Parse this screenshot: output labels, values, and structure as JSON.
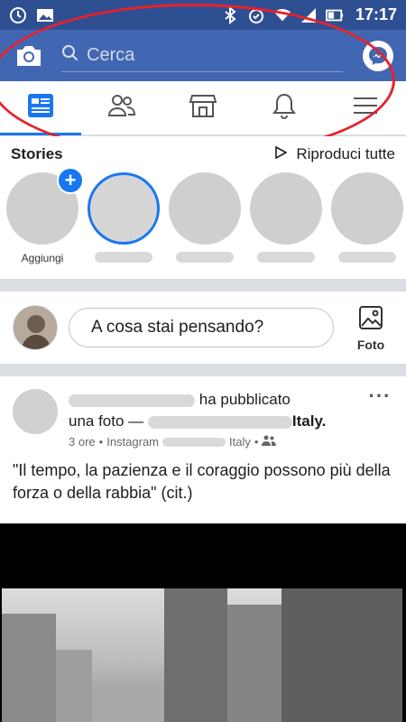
{
  "status_bar": {
    "time": "17:17",
    "left_icons": [
      "alarm-clock-icon",
      "image-icon"
    ],
    "right_icons": [
      "bluetooth-icon",
      "alarm-icon",
      "wifi-icon",
      "signal-icon",
      "battery-icon"
    ]
  },
  "header": {
    "camera_icon": "camera-icon",
    "search_placeholder": "Cerca",
    "messenger_icon": "messenger-icon",
    "color": "#4267b2"
  },
  "tabs": [
    {
      "name": "news-feed",
      "icon": "news-feed-icon",
      "active": true
    },
    {
      "name": "friends",
      "icon": "friends-icon",
      "active": false
    },
    {
      "name": "marketplace",
      "icon": "marketplace-icon",
      "active": false
    },
    {
      "name": "notifications",
      "icon": "bell-icon",
      "active": false
    },
    {
      "name": "menu",
      "icon": "hamburger-menu-icon",
      "active": false
    }
  ],
  "stories": {
    "title": "Stories",
    "play_all": "Riproduci tutte",
    "add_label": "Aggiungi"
  },
  "composer": {
    "placeholder": "A cosa stai pensando?",
    "photo_label": "Foto"
  },
  "post": {
    "action_text": "ha pubblicato",
    "line2_prefix": "una foto —",
    "line2_suffix": "Italy.",
    "time": "3 ore",
    "source": "Instagram",
    "location_suffix": "Italy",
    "caption": "\"Il tempo, la pazienza e il coraggio possono più della forza o della rabbia\" (cit.)"
  },
  "accent_color": "#1877f2",
  "annotation_color": "#e5222c"
}
